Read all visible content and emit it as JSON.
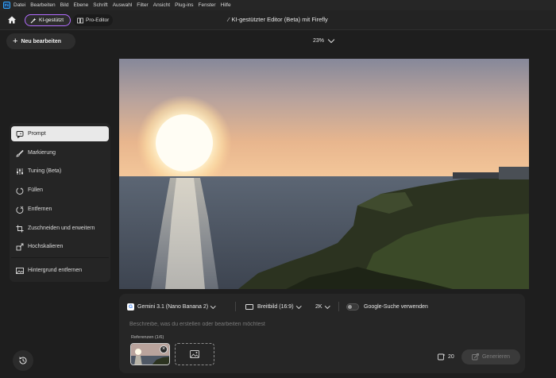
{
  "menubar": {
    "logo": "Ps",
    "items": [
      "Datei",
      "Bearbeiten",
      "Bild",
      "Ebene",
      "Schrift",
      "Auswahl",
      "Filter",
      "Ansicht",
      "Plug-ins",
      "Fenster",
      "Hilfe"
    ]
  },
  "toolbar": {
    "mode_ai_label": "KI-gestützt",
    "mode_pro_label": "Pro-Editor",
    "doc_title": "KI-gestützter Editor (Beta) mit Firefly",
    "accent_color": "#b26cff"
  },
  "new_edit_label": "Neu bearbeiten",
  "zoom_level": "23%",
  "sidebar": {
    "items": [
      {
        "label": "Prompt",
        "icon": "prompt-icon",
        "active": true
      },
      {
        "label": "Markierung",
        "icon": "selection-brush-icon",
        "active": false
      },
      {
        "label": "Tuning (Beta)",
        "icon": "tuning-icon",
        "active": false
      },
      {
        "label": "Füllen",
        "icon": "fill-icon",
        "active": false
      },
      {
        "label": "Entfernen",
        "icon": "remove-icon",
        "active": false
      },
      {
        "label": "Zuschneiden und erweitern",
        "icon": "crop-icon",
        "active": false
      },
      {
        "label": "Hochskalieren",
        "icon": "upscale-icon",
        "active": false
      },
      {
        "label": "Hintergrund entfernen",
        "icon": "remove-background-icon",
        "active": false
      }
    ]
  },
  "prompt_panel": {
    "model": "Gemini 3.1 (Nano Banana 2)",
    "aspect_ratio": "Breitbild (16:9)",
    "resolution": "2K",
    "google_search_label": "Google-Suche verwenden",
    "google_search_enabled": false,
    "placeholder": "Beschreibe, was du erstellen oder bearbeiten möchtest",
    "references_label": "Referenzen (1/6)",
    "credits": "20",
    "generate_label": "Generieren"
  }
}
